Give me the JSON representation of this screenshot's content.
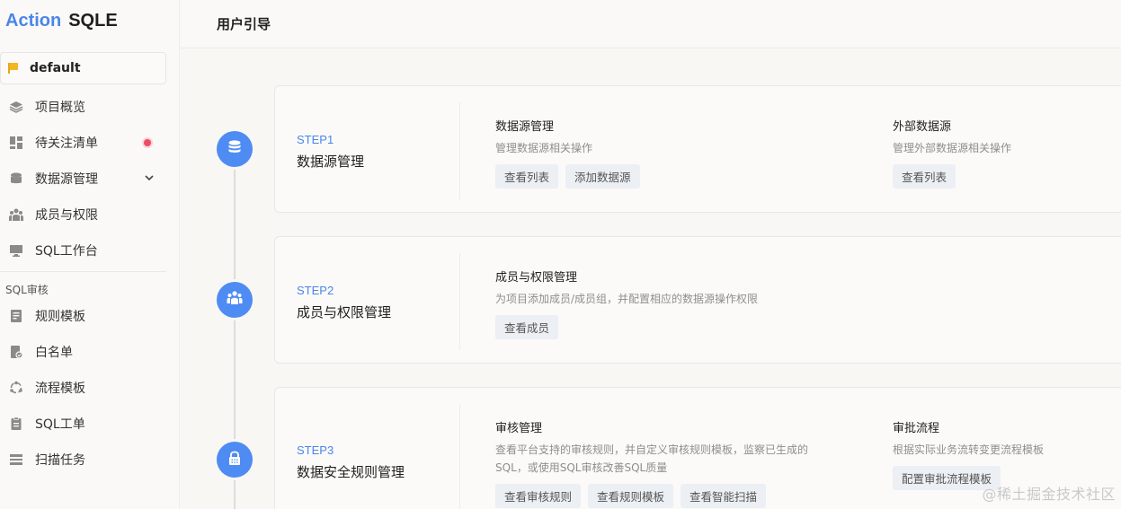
{
  "logo": {
    "part1": "Action",
    "part2": "SQLE"
  },
  "project": {
    "name": "default"
  },
  "sidebar": {
    "items": [
      {
        "label": "项目概览"
      },
      {
        "label": "待关注清单"
      },
      {
        "label": "数据源管理"
      },
      {
        "label": "成员与权限"
      },
      {
        "label": "SQL工作台"
      }
    ],
    "section": "SQL审核",
    "audit_items": [
      {
        "label": "规则模板"
      },
      {
        "label": "白名单"
      },
      {
        "label": "流程模板"
      },
      {
        "label": "SQL工单"
      },
      {
        "label": "扫描任务"
      }
    ]
  },
  "header": {
    "title": "用户引导"
  },
  "steps": [
    {
      "label": "STEP1",
      "title": "数据源管理",
      "groups": [
        {
          "title": "数据源管理",
          "desc": "管理数据源相关操作",
          "buttons": [
            "查看列表",
            "添加数据源"
          ]
        },
        {
          "title": "外部数据源",
          "desc": "管理外部数据源相关操作",
          "buttons": [
            "查看列表"
          ]
        }
      ]
    },
    {
      "label": "STEP2",
      "title": "成员与权限管理",
      "groups": [
        {
          "title": "成员与权限管理",
          "desc": "为项目添加成员/成员组，并配置相应的数据源操作权限",
          "buttons": [
            "查看成员"
          ]
        }
      ]
    },
    {
      "label": "STEP3",
      "title": "数据安全规则管理",
      "groups": [
        {
          "title": "审核管理",
          "desc_line1": "查看平台支持的审核规则，并自定义审核规则模板，监察已生成的",
          "desc_line2": "SQL，或使用SQL审核改善SQL质量",
          "buttons": [
            "查看审核规则",
            "查看规则模板",
            "查看智能扫描"
          ]
        },
        {
          "title": "审批流程",
          "desc": "根据实际业务流转变更流程模板",
          "buttons": [
            "配置审批流程模板"
          ]
        }
      ]
    }
  ],
  "watermark": "@稀土掘金技术社区",
  "colors": {
    "accent": "#4a86e8",
    "step_circle": "#4e8cf3",
    "badge": "#f04a63",
    "flag": "#f2b824"
  }
}
